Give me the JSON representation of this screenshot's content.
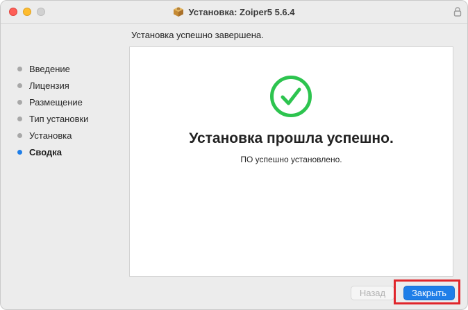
{
  "window": {
    "title": "Установка: Zoiper5 5.6.4"
  },
  "header": {
    "status": "Установка успешно завершена."
  },
  "sidebar": {
    "items": [
      {
        "label": "Введение",
        "active": false
      },
      {
        "label": "Лицензия",
        "active": false
      },
      {
        "label": "Размещение",
        "active": false
      },
      {
        "label": "Тип установки",
        "active": false
      },
      {
        "label": "Установка",
        "active": false
      },
      {
        "label": "Сводка",
        "active": true
      }
    ]
  },
  "main": {
    "heading": "Установка прошла успешно.",
    "message": "ПО успешно установлено."
  },
  "buttons": {
    "back_label": "Назад",
    "close_label": "Закрыть"
  },
  "colors": {
    "accent": "#1f7ee8",
    "success": "#2dc44f",
    "highlight": "#e0252b"
  },
  "icons": {
    "package": "package-icon",
    "lock": "lock-icon",
    "success": "checkmark-circle-icon"
  }
}
